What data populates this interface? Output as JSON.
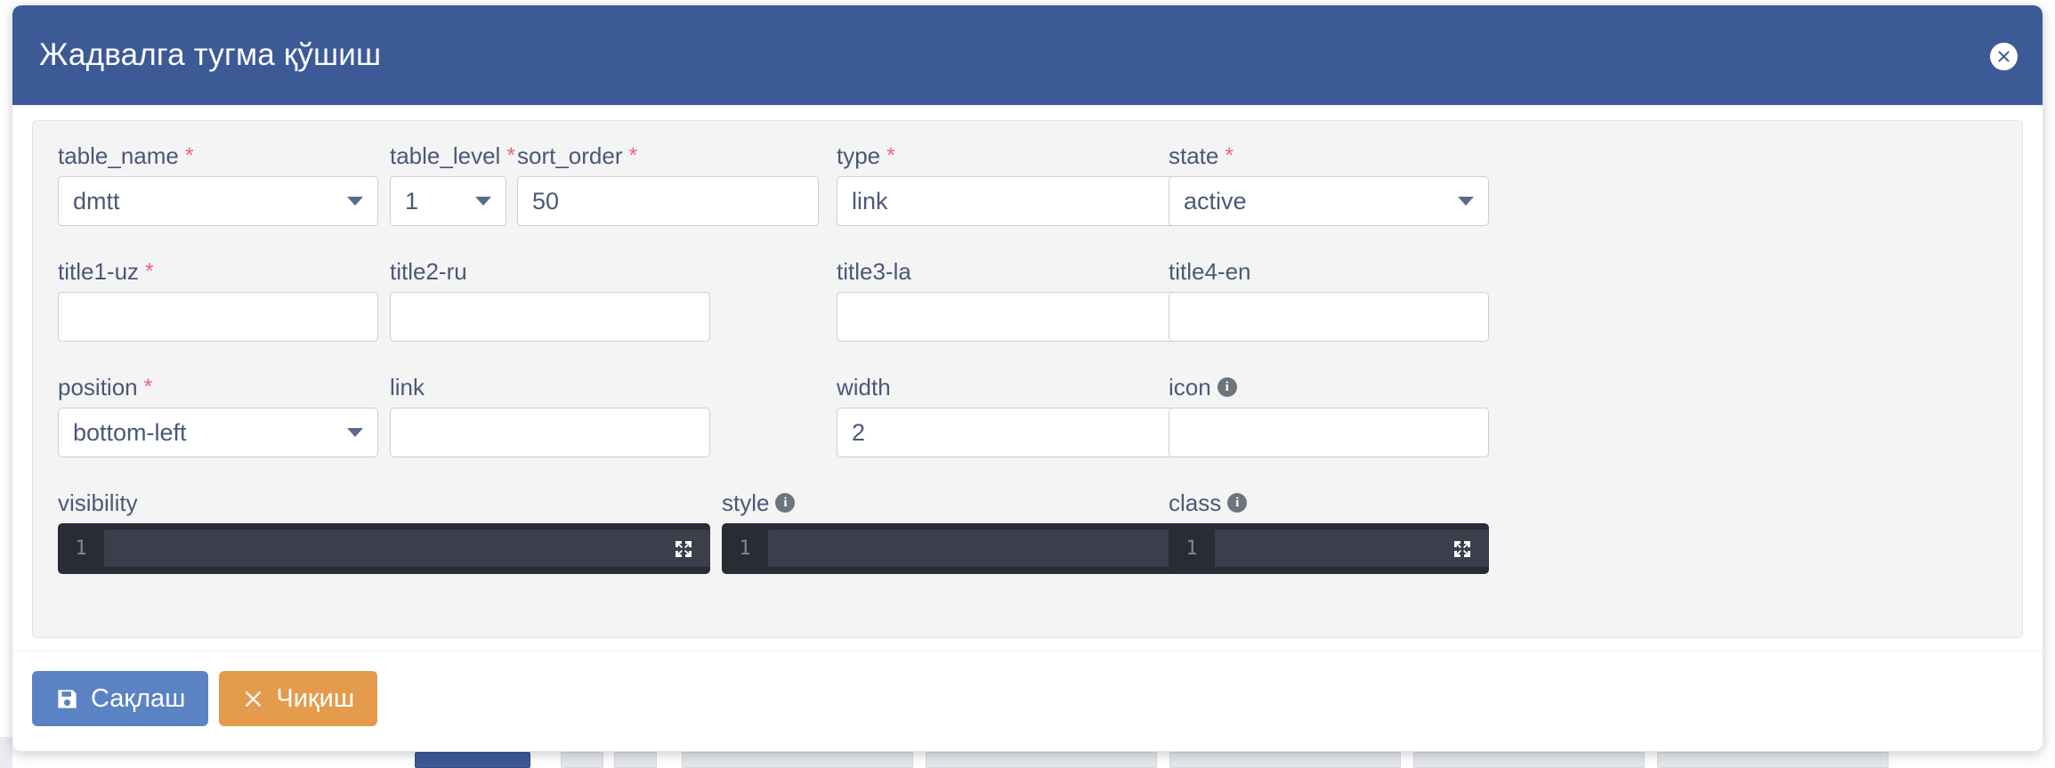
{
  "colors": {
    "header_blue": "#3c5a96",
    "save_blue": "#5b83c4",
    "exit_orange": "#e49b4c",
    "required_red": "#e8697a",
    "label_slate": "#4a5878",
    "panel_bg": "#f4f4f5",
    "editor_bg": "#282c34"
  },
  "header": {
    "title": "Жадвалга тугма қўшиш",
    "close_icon": "close-circle-icon"
  },
  "form": {
    "row1": [
      {
        "label": "table_name",
        "required": true,
        "control": "select",
        "value": "dmtt",
        "name": "table-name"
      },
      {
        "label": "table_level",
        "required": true,
        "control": "select",
        "value": "1",
        "name": "table-level"
      },
      {
        "label": "sort_order",
        "required": true,
        "control": "input",
        "value": "50",
        "name": "sort-order"
      },
      {
        "label": "type",
        "required": true,
        "control": "select",
        "value": "link",
        "name": "type"
      },
      {
        "label": "state",
        "required": true,
        "control": "select",
        "value": "active",
        "name": "state"
      }
    ],
    "row2": [
      {
        "label": "title1-uz",
        "required": true,
        "control": "input",
        "value": "",
        "name": "title1-uz"
      },
      {
        "label": "title2-ru",
        "required": false,
        "control": "input",
        "value": "",
        "name": "title2-ru"
      },
      {
        "label": "title3-la",
        "required": false,
        "control": "input",
        "value": "",
        "name": "title3-la"
      },
      {
        "label": "title4-en",
        "required": false,
        "control": "input",
        "value": "",
        "name": "title4-en"
      }
    ],
    "row3": [
      {
        "label": "position",
        "required": true,
        "control": "select",
        "value": "bottom-left",
        "name": "position"
      },
      {
        "label": "link",
        "required": false,
        "control": "input",
        "value": "",
        "name": "link"
      },
      {
        "label": "width",
        "required": false,
        "control": "input",
        "value": "2",
        "name": "width"
      },
      {
        "label": "icon",
        "required": false,
        "control": "input",
        "value": "",
        "info": true,
        "name": "icon"
      }
    ],
    "row4": [
      {
        "label": "visibility",
        "required": false,
        "control": "editor",
        "line_number": "1",
        "value": "",
        "info": false,
        "name": "visibility"
      },
      {
        "label": "style",
        "required": false,
        "control": "editor",
        "line_number": "1",
        "value": "",
        "info": true,
        "name": "style"
      },
      {
        "label": "class",
        "required": false,
        "control": "editor",
        "line_number": "1",
        "value": "",
        "info": true,
        "name": "class"
      }
    ]
  },
  "footer": {
    "save_label": "Сақлаш",
    "save_icon": "floppy-disk-icon",
    "exit_label": "Чиқиш",
    "exit_icon": "times-icon"
  }
}
